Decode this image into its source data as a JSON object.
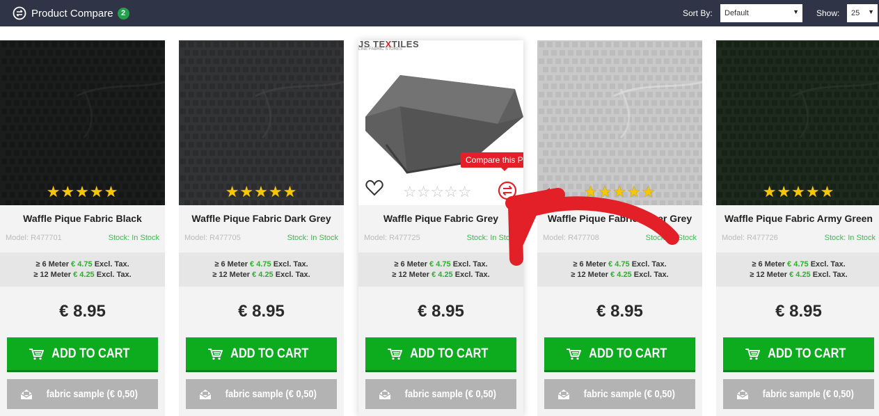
{
  "header": {
    "compare_label": "Product Compare",
    "compare_count": "2",
    "sort_label": "Sort By:",
    "sort_value": "Default",
    "show_label": "Show:",
    "show_value": "25"
  },
  "tooltip": "Compare this Product",
  "image_logo": {
    "brand_start": "JS TE",
    "brand_x": "X",
    "brand_end": "TILES",
    "tagline": "LINE FABRIC STORES"
  },
  "colors": {
    "accent_green": "#0dab1e",
    "topbar": "#2f3447",
    "tooltip_red": "#e32028",
    "stock_green": "#3eb84f"
  },
  "products": [
    {
      "name": "Waffle Pique Fabric Black",
      "model": "Model: R477701",
      "stock": "Stock: In Stock",
      "tier1_prefix": "≥ 6 Meter",
      "tier1_price": "€ 4.75",
      "tier1_suffix": "Excl. Tax.",
      "tier2_prefix": "≥ 12 Meter",
      "tier2_price": "€ 4.25",
      "tier2_suffix": "Excl. Tax.",
      "price": "€ 8.95",
      "cart_label": "ADD TO CART",
      "sample_label": "fabric sample (€ 0,50)",
      "stars": "★★★★★"
    },
    {
      "name": "Waffle Pique Fabric Dark Grey",
      "model": "Model: R477705",
      "stock": "Stock: In Stock",
      "tier1_prefix": "≥ 6 Meter",
      "tier1_price": "€ 4.75",
      "tier1_suffix": "Excl. Tax.",
      "tier2_prefix": "≥ 12 Meter",
      "tier2_price": "€ 4.25",
      "tier2_suffix": "Excl. Tax.",
      "price": "€ 8.95",
      "cart_label": "ADD TO CART",
      "sample_label": "fabric sample (€ 0,50)",
      "stars": "★★★★★"
    },
    {
      "name": "Waffle Pique Fabric Grey",
      "model": "Model: R477725",
      "stock": "Stock: In Stock",
      "tier1_prefix": "≥ 6 Meter",
      "tier1_price": "€ 4.75",
      "tier1_suffix": "Excl. Tax.",
      "tier2_prefix": "≥ 12 Meter",
      "tier2_price": "€ 4.25",
      "tier2_suffix": "Excl. Tax.",
      "price": "€ 8.95",
      "cart_label": "ADD TO CART",
      "sample_label": "fabric sample (€ 0,50)",
      "stars": "☆☆☆☆☆"
    },
    {
      "name": "Waffle Pique Fabric Silver Grey",
      "model": "Model: R477708",
      "stock": "Stock: In Stock",
      "tier1_prefix": "≥ 6 Meter",
      "tier1_price": "€ 4.75",
      "tier1_suffix": "Excl. Tax.",
      "tier2_prefix": "≥ 12 Meter",
      "tier2_price": "€ 4.25",
      "tier2_suffix": "Excl. Tax.",
      "price": "€ 8.95",
      "cart_label": "ADD TO CART",
      "sample_label": "fabric sample (€ 0,50)",
      "stars": "★★★★★"
    },
    {
      "name": "Waffle Pique Fabric Army Green",
      "model": "Model: R477726",
      "stock": "Stock: In Stock",
      "tier1_prefix": "≥ 6 Meter",
      "tier1_price": "€ 4.75",
      "tier1_suffix": "Excl. Tax.",
      "tier2_prefix": "≥ 12 Meter",
      "tier2_price": "€ 4.25",
      "tier2_suffix": "Excl. Tax.",
      "price": "€ 8.95",
      "cart_label": "ADD TO CART",
      "sample_label": "fabric sample (€ 0,50)",
      "stars": "★★★★★"
    }
  ]
}
